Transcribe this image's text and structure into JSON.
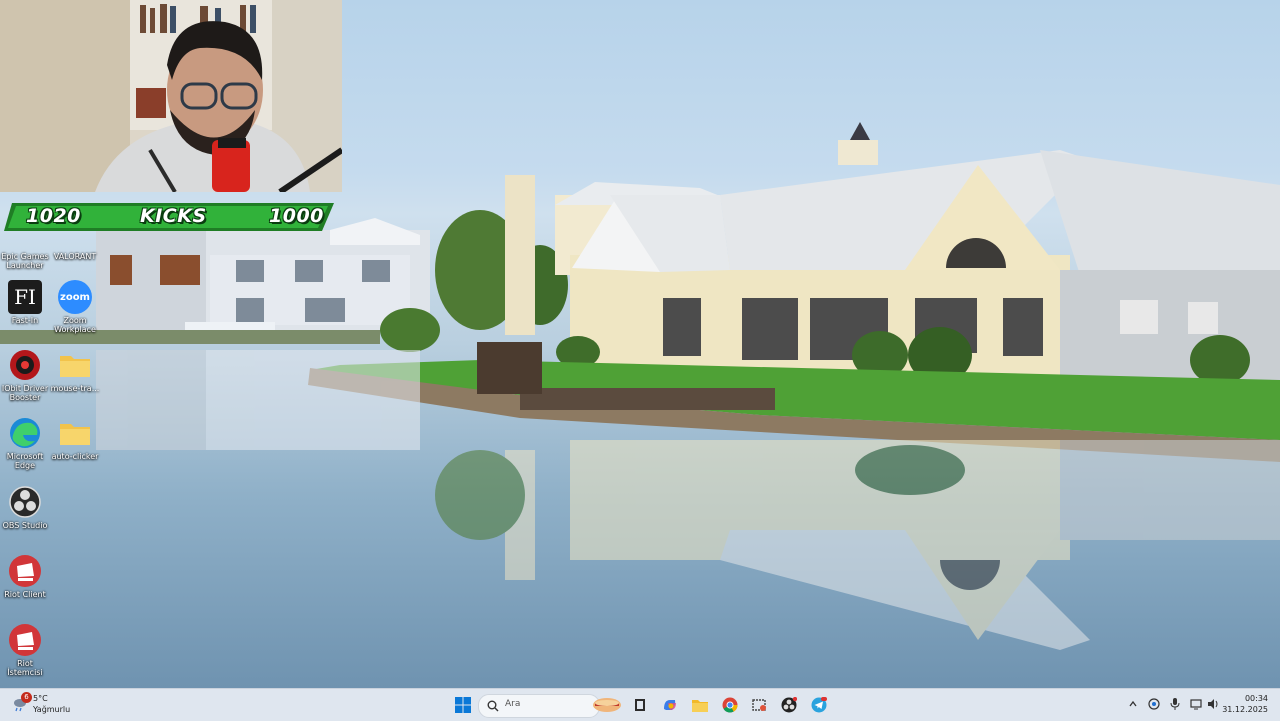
{
  "overlay": {
    "kicks_label": "KICKS",
    "kicks_left": "1020",
    "kicks_right": "1000"
  },
  "desktop_icons": [
    {
      "label": "Epic Games Launcher",
      "icon": "epic-games-icon"
    },
    {
      "label": "VALORANT",
      "icon": "valorant-icon"
    },
    {
      "label": "Fast-In",
      "icon": "fastin-icon"
    },
    {
      "label": "Zoom Workplace",
      "icon": "zoom-icon",
      "glyph_text": "zoom"
    },
    {
      "label": "IObit Driver Booster",
      "icon": "driver-booster-icon"
    },
    {
      "label": "mouse-tra...",
      "icon": "folder-icon"
    },
    {
      "label": "Microsoft Edge",
      "icon": "edge-icon"
    },
    {
      "label": "auto-clicker",
      "icon": "folder-icon"
    },
    {
      "label": "OBS Studio",
      "icon": "obs-icon"
    },
    {
      "label": "Riot Client",
      "icon": "riot-client-icon"
    },
    {
      "label": "Riot İstemcisi",
      "icon": "riot-client-icon"
    }
  ],
  "taskbar": {
    "weather": {
      "temp": "5°C",
      "condition": "Yağmurlu",
      "badge": "6"
    },
    "search_placeholder": "Ara",
    "apps": [
      "windows-start-icon",
      "search-icon",
      "widget-icon",
      "task-view-icon",
      "copilot-icon",
      "file-explorer-icon",
      "chrome-icon",
      "snipping-tool-icon",
      "obs-icon",
      "telegram-icon"
    ],
    "tray": [
      "chevron-up-icon",
      "network-icon",
      "microphone-icon",
      "display-icon",
      "volume-icon"
    ],
    "time": "00:34",
    "date": "31.12.2025"
  },
  "colors": {
    "accent_green": "#2faa36",
    "taskbar": "#dfe6ef"
  }
}
